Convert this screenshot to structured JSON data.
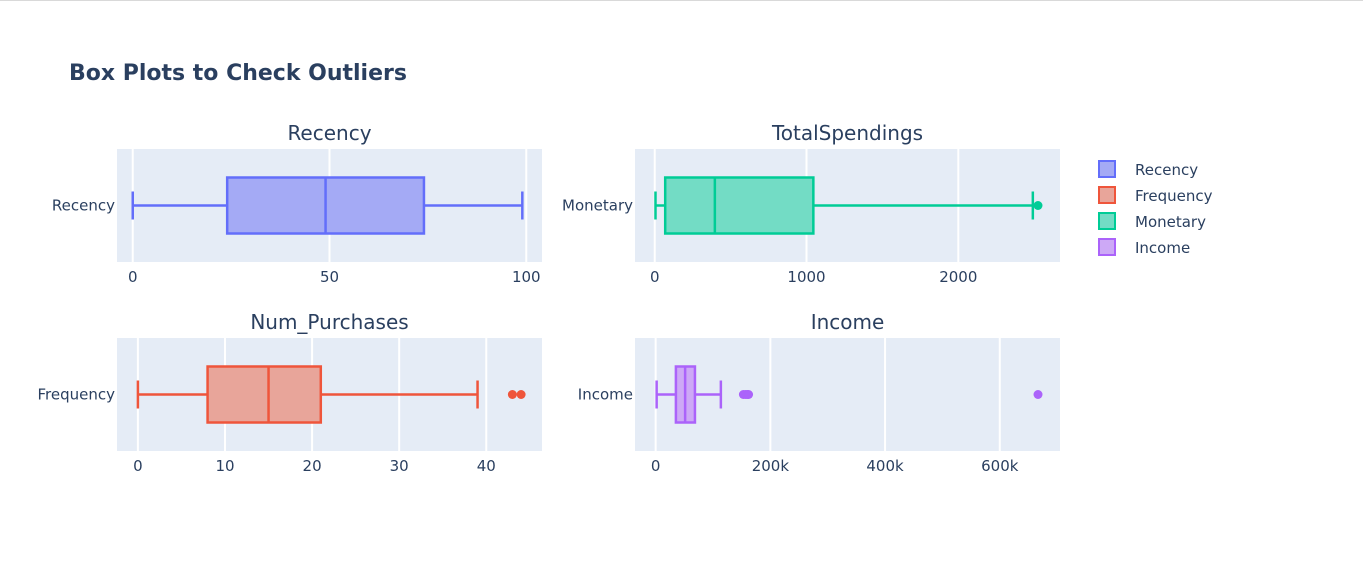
{
  "title": "Box Plots to Check Outliers",
  "chart_data": [
    {
      "type": "box",
      "title": "Recency",
      "category": "Recency",
      "series_name": "Recency",
      "color": "#636efa",
      "fill": "#a4aaf5",
      "xlim": [
        -4,
        104
      ],
      "ticks": [
        0,
        50,
        100
      ],
      "tick_labels": [
        "0",
        "50",
        "100"
      ],
      "min": 0,
      "q1": 24,
      "median": 49,
      "q3": 74,
      "max": 99,
      "outliers": []
    },
    {
      "type": "box",
      "title": "TotalSpendings",
      "category": "Monetary",
      "series_name": "Monetary",
      "color": "#00cc96",
      "fill": "#73dcc5",
      "xlim": [
        -130,
        2670
      ],
      "ticks": [
        0,
        1000,
        2000
      ],
      "tick_labels": [
        "0",
        "1000",
        "2000"
      ],
      "min": 5,
      "q1": 69,
      "median": 396,
      "q3": 1045,
      "max": 2491,
      "outliers": [
        2525
      ]
    },
    {
      "type": "box",
      "title": "Num_Purchases",
      "category": "Frequency",
      "series_name": "Frequency",
      "color": "#ef553b",
      "fill": "#e8a59a",
      "xlim": [
        -2.4,
        46.4
      ],
      "ticks": [
        0,
        10,
        20,
        30,
        40
      ],
      "tick_labels": [
        "0",
        "10",
        "20",
        "30",
        "40"
      ],
      "min": 0,
      "q1": 8,
      "median": 15,
      "q3": 21,
      "max": 39,
      "outliers": [
        43,
        44
      ]
    },
    {
      "type": "box",
      "title": "Income",
      "category": "Income",
      "series_name": "Income",
      "color": "#ab63fa",
      "fill": "#cda9f6",
      "xlim": [
        -36000,
        705000
      ],
      "ticks": [
        0,
        200000,
        400000,
        600000
      ],
      "tick_labels": [
        "0",
        "200k",
        "400k",
        "600k"
      ],
      "min": 1730,
      "q1": 35300,
      "median": 51400,
      "q3": 68500,
      "max": 113700,
      "outliers": [
        153000,
        157000,
        160000,
        162000,
        666666
      ]
    }
  ],
  "legend": [
    {
      "label": "Recency",
      "color": "#636efa",
      "fill": "#a4aaf5"
    },
    {
      "label": "Frequency",
      "color": "#ef553b",
      "fill": "#e8a59a"
    },
    {
      "label": "Monetary",
      "color": "#00cc96",
      "fill": "#73dcc5"
    },
    {
      "label": "Income",
      "color": "#ab63fa",
      "fill": "#cda9f6"
    }
  ]
}
